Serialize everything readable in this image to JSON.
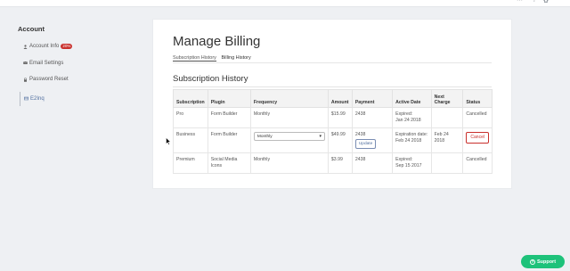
{
  "sidebar": {
    "title": "Account",
    "items": [
      {
        "label": "Account Info",
        "icon": "user-icon",
        "badge": "20%"
      },
      {
        "label": "Email Settings",
        "icon": "envelope-icon"
      },
      {
        "label": "Password Reset",
        "icon": "lock-icon"
      },
      {
        "label": "E2Inq",
        "icon": "card-icon",
        "active": true
      }
    ]
  },
  "main": {
    "title": "Manage Billing",
    "tabs": [
      "Subscription History",
      "Billing History"
    ],
    "section_title": "Subscription History",
    "table": {
      "headers": [
        "Subscription",
        "Plugin",
        "Frequency",
        "Amount",
        "Payment",
        "Active Date",
        "Next Charge",
        "Status"
      ],
      "rows": [
        {
          "subscription": "Pro",
          "plugin": "Form Builder",
          "frequency": "Monthly",
          "amount": "$15.99",
          "payment": "2438",
          "active_label": "Expired:",
          "active_date": "Jan 24 2018",
          "next_charge": "",
          "status": "Cancelled"
        },
        {
          "subscription": "Business",
          "plugin": "Form Builder",
          "frequency_select": "Monthly",
          "amount": "$49.99",
          "payment": "2438",
          "update_label": "Update",
          "active_label": "Expiration date:",
          "active_date": "Feb 24 2018",
          "next_charge": "Feb 24 2018",
          "status_button": "Cancel"
        },
        {
          "subscription": "Premium",
          "plugin": "Social Media Icons",
          "frequency": "Monthly",
          "amount": "$3.99",
          "payment": "2438",
          "active_label": "Expired:",
          "active_date": "Sep 15 2017",
          "next_charge": "",
          "status": "Cancelled"
        }
      ]
    }
  },
  "support_label": "Support",
  "colors": {
    "danger": "#c9302c",
    "support": "#1ec27a",
    "update": "#5270a0"
  }
}
